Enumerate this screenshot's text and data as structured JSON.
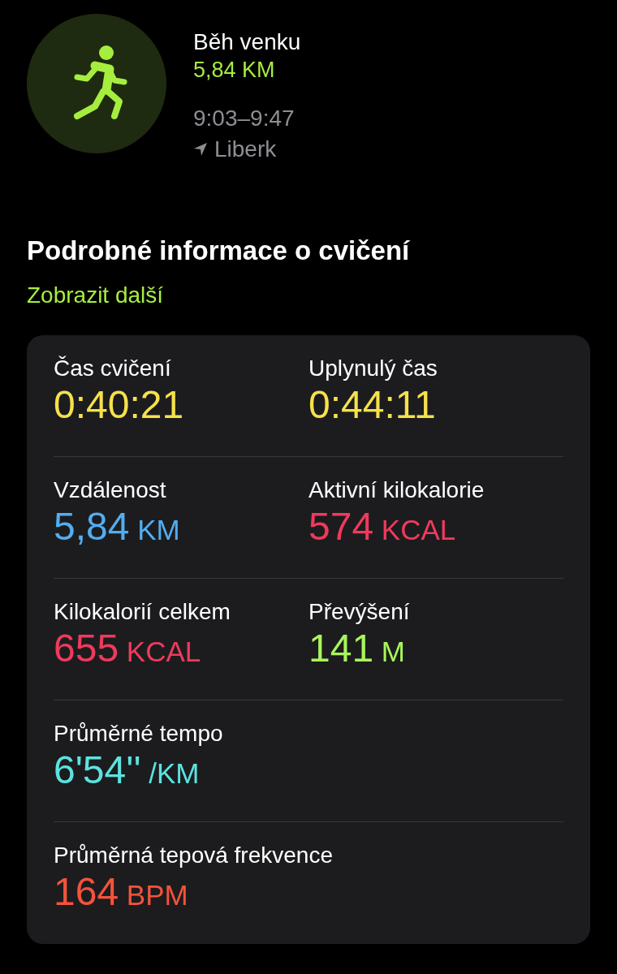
{
  "workout": {
    "title": "Běh venku",
    "distance": "5,84 KM",
    "time": "9:03–9:47",
    "location": "Liberk"
  },
  "details": {
    "heading": "Podrobné informace o cvičení",
    "link": "Zobrazit další",
    "rows": [
      {
        "cells": [
          {
            "label": "Čas cvičení",
            "value": "0:40:21",
            "color": "#f6e14b"
          },
          {
            "label": "Uplynulý čas",
            "value": "0:44:11",
            "color": "#f6e14b"
          }
        ]
      },
      {
        "cells": [
          {
            "label": "Vzdálenost",
            "value": "5,84",
            "unit": "KM",
            "color": "#52adf0"
          },
          {
            "label": "Aktivní kilokalorie",
            "value": "574",
            "unit": "KCAL",
            "color": "#ef3a5c"
          }
        ]
      },
      {
        "cells": [
          {
            "label": "Kilokalorií celkem",
            "value": "655",
            "unit": "KCAL",
            "color": "#ef3a5c"
          },
          {
            "label": "Převýšení",
            "value": "141",
            "unit": "M",
            "color": "#a8f55c"
          }
        ]
      },
      {
        "cells": [
          {
            "label": "Průměrné tempo",
            "value": "6'54''",
            "unit": "/KM",
            "color": "#5ce3df"
          }
        ]
      },
      {
        "cells": [
          {
            "label": "Průměrná tepová frekvence",
            "value": "164",
            "unit": "BPM",
            "color": "#f4533c"
          }
        ]
      }
    ]
  }
}
